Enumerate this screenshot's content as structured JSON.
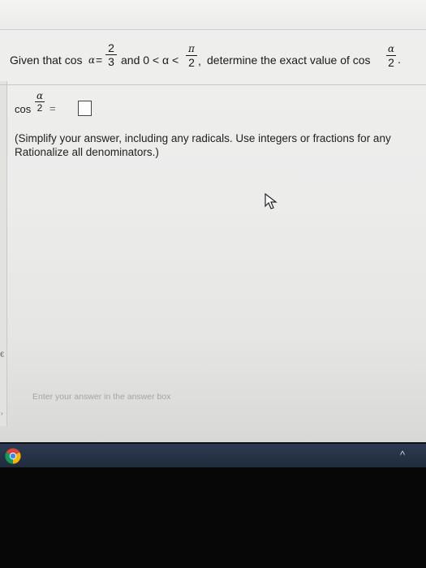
{
  "question": {
    "prefix": "Given that cos",
    "alpha": "α",
    "equals": "=",
    "cos_num": "2",
    "cos_den": "3",
    "cond_text": "and 0 < α <",
    "pi": "π",
    "pi_den": "2",
    "comma": ",",
    "tail": "determine the exact value of cos",
    "half_den": "2",
    "end": "."
  },
  "answer": {
    "cos_label": "cos",
    "alpha": "α",
    "den": "2",
    "equals": "="
  },
  "instructions": {
    "line1": "(Simplify your answer, including any radicals. Use integers or fractions for any",
    "line2": "Rationalize all denominators.)"
  },
  "hint": "Enter your answer in the answer box",
  "left_marker": "€",
  "left_arrow": "›",
  "taskbar": {
    "tray_chevron": "^"
  },
  "colors": {
    "taskbar": "#243148",
    "chrome_red": "#db4437",
    "chrome_green": "#0f9d58",
    "chrome_yellow": "#f4b400",
    "chrome_blue": "#4285f4"
  }
}
